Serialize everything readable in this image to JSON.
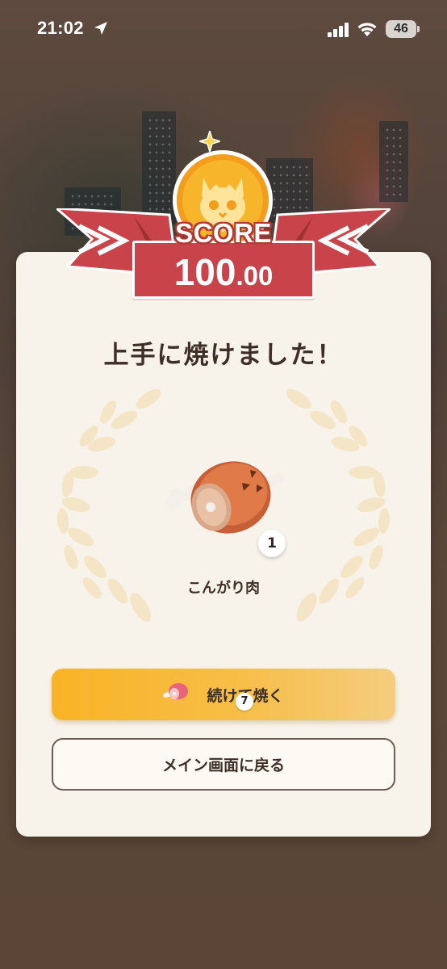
{
  "status_bar": {
    "time": "21:02",
    "battery": "46"
  },
  "score": {
    "label": "SCORE",
    "integer": "100",
    "decimal": ".00"
  },
  "result": {
    "headline": "上手に焼けました！",
    "item_name": "こんがり肉",
    "item_quantity": "1",
    "item_icon": "grilled-meat-icon"
  },
  "actions": {
    "continue_label": "続けて焼く",
    "continue_cost": "7",
    "back_label": "メイン画面に戻る"
  },
  "colors": {
    "ribbon_red": "#c9444a",
    "medal_gold": "#f6b52a",
    "button_orange": "#f9b325",
    "card_bg": "#f8f3ea"
  }
}
